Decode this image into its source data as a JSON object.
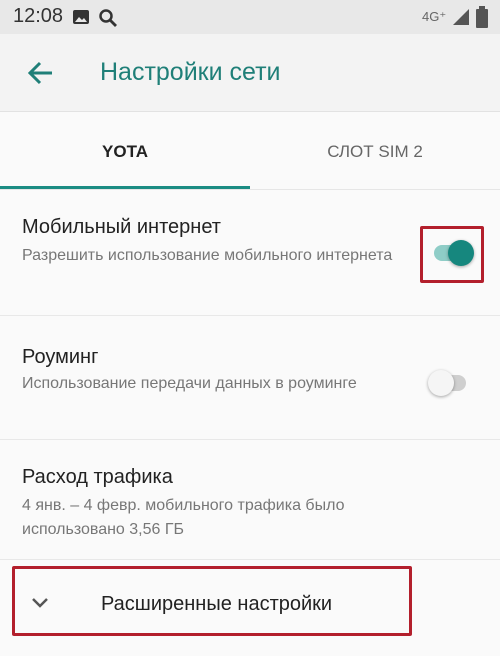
{
  "status_bar": {
    "time": "12:08",
    "network": "4G⁺",
    "icons": [
      "gallery-icon",
      "search-icon",
      "signal-icon",
      "battery-icon"
    ]
  },
  "app_bar": {
    "title": "Настройки сети",
    "back_icon": "arrow-back-icon"
  },
  "tabs": [
    {
      "label": "YOTA",
      "selected": true
    },
    {
      "label": "СЛОТ SIM 2",
      "selected": false
    }
  ],
  "settings": [
    {
      "title": "Мобильный интернет",
      "subtitle": "Разрешить использование мобильного интернета",
      "toggle": true
    },
    {
      "title": "Роуминг",
      "subtitle": "Использование передачи данных в роуминге",
      "toggle": false
    },
    {
      "title": "Расход трафика",
      "subtitle": "4 янв. – 4 февр. мобильного трафика было использовано 3,56 ГБ"
    }
  ],
  "advanced": {
    "label": "Расширенные настройки",
    "icon": "chevron-down-icon"
  },
  "colors": {
    "accent": "#1b8c83",
    "highlight": "#b31f2c"
  }
}
